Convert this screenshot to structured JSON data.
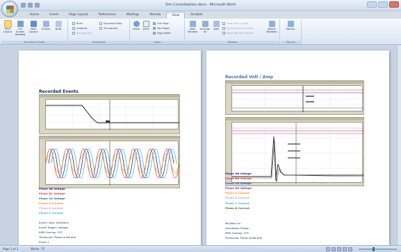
{
  "window": {
    "title": "Sim Consolidation.docx - Microsoft Word"
  },
  "tabs": [
    "Home",
    "Insert",
    "Page Layout",
    "References",
    "Mailings",
    "Review",
    "View",
    "Acrobat"
  ],
  "active_tab": "View",
  "ribbon": {
    "document_views": {
      "label": "Document Views",
      "buttons": [
        "Print Layout",
        "Full Screen Reading",
        "Web Layout",
        "Outline",
        "Draft"
      ]
    },
    "show_hide": {
      "label": "Show/Hide",
      "items": [
        "Ruler",
        "Gridlines",
        "Message Bar",
        "Document Map",
        "Thumbnails"
      ]
    },
    "zoom": {
      "label": "Zoom",
      "buttons": [
        "Zoom",
        "100%",
        "One Page",
        "Two Pages",
        "Page Width"
      ]
    },
    "window": {
      "label": "Window",
      "buttons": [
        "New Window",
        "Arrange All",
        "Split"
      ],
      "items": [
        "View Side by Side",
        "Synchronous Scrolling",
        "Reset Window Position"
      ],
      "switch": "Switch Windows"
    },
    "macros": {
      "label": "Macros",
      "button": "Macros"
    }
  },
  "left_page": {
    "heading": "Recorded Events",
    "legend": [
      {
        "text": "Phase AB Voltage",
        "color": "#1a237e"
      },
      {
        "text": "Phase BC Voltage",
        "color": "#e53935"
      },
      {
        "text": "Phase CA Voltage",
        "color": "#1565c0"
      },
      {
        "text": "Phase A Current",
        "color": "#ff9800"
      },
      {
        "text": "Phase B Current",
        "color": "#f48fb1"
      },
      {
        "text": "Phase C Current",
        "color": "#29b6f6"
      }
    ],
    "notes": [
      "Event Class: Tolerance",
      "Event Trigger: Voltage",
      "RMS Overlay: OFF",
      "Timescale: Phase to Neutral",
      "Event 1"
    ]
  },
  "right_page": {
    "heading": "Recorded Volt / Amp",
    "legend": [
      {
        "text": "Phase AN Voltage",
        "color": "#1a237e"
      },
      {
        "text": "Phase BN Voltage",
        "color": "#e53935"
      },
      {
        "text": "Phase CN Voltage",
        "color": "#1565c0"
      },
      {
        "text": "Phase NG Voltage",
        "color": "#8e24aa"
      },
      {
        "text": "Phase A Current",
        "color": "#ff9800"
      },
      {
        "text": "Phase B Current",
        "color": "#f48fb1"
      },
      {
        "text": "Phase C Current",
        "color": "#29b6f6"
      },
      {
        "text": "Phase N Current",
        "color": "#2e7d32"
      }
    ],
    "notes": [
      "Min/Max On",
      "Annotation Shown",
      "RMS Overlay: OFF",
      "Timescale: Phase to Neutral"
    ]
  },
  "status": {
    "page": "Page 1 of 2",
    "words": "Words: 72"
  }
}
